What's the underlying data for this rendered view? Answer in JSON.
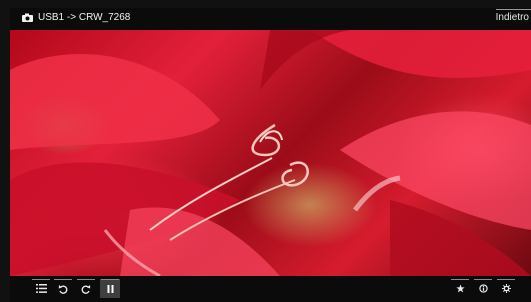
{
  "header": {
    "breadcrumb": "USB1 -> CRW_7268",
    "source_icon": "camera-icon",
    "back_label": "Indietro"
  },
  "toolbar": {
    "left": [
      {
        "name": "list-button",
        "icon": "list-icon"
      },
      {
        "name": "rotate-left-button",
        "icon": "rotate-left-icon"
      },
      {
        "name": "rotate-right-button",
        "icon": "rotate-right-icon"
      },
      {
        "name": "pause-button",
        "icon": "pause-icon",
        "active": true
      }
    ],
    "right": [
      {
        "name": "favorite-button",
        "icon": "star-icon"
      },
      {
        "name": "info-button",
        "icon": "info-icon"
      },
      {
        "name": "settings-button",
        "icon": "gear-icon"
      }
    ]
  },
  "colors": {
    "bar_background": "#0b0b0b",
    "active_button": "#3f3f3f",
    "text": "#f2f2f2"
  }
}
